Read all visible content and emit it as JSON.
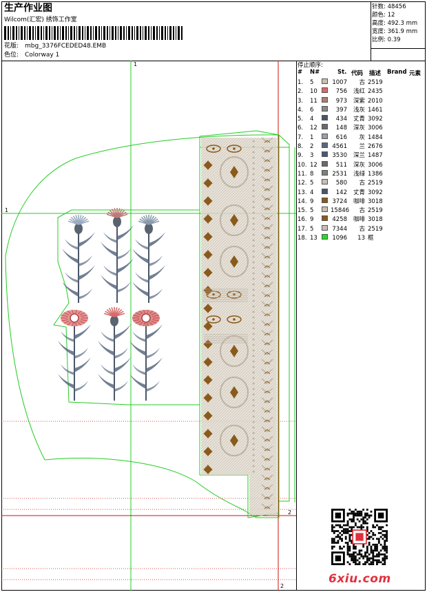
{
  "header": {
    "title": "生产作业图",
    "company": "Wilcom(汇宏) 绣饰工作室",
    "pattern_label": "花版:",
    "pattern_value": "mbg_3376FCEDED48.EMB",
    "color_label": "色位:",
    "color_value": "Colorway 1"
  },
  "stats": [
    {
      "label": "针数:",
      "value": "48456"
    },
    {
      "label": "颜色:",
      "value": "12"
    },
    {
      "label": "高度:",
      "value": "492.3 mm"
    },
    {
      "label": "宽度:",
      "value": "361.9 mm"
    },
    {
      "label": "比例:",
      "value": "0.39"
    }
  ],
  "sequence": {
    "title": "停止顺序:",
    "headers": {
      "num": "#",
      "needle": "N#",
      "st": "St.",
      "code": "代码",
      "desc": "描述",
      "brand": "Brand",
      "element": "元素"
    },
    "rows": [
      {
        "n": "1.",
        "needle": "5",
        "color": "#c8bfb4",
        "st": "1007",
        "code": "古",
        "desc": "2519"
      },
      {
        "n": "2.",
        "needle": "10",
        "color": "#d96a6a",
        "st": "756",
        "code": "浅红",
        "desc": "2435"
      },
      {
        "n": "3.",
        "needle": "11",
        "color": "#b08070",
        "st": "973",
        "code": "深紫",
        "desc": "2010"
      },
      {
        "n": "4.",
        "needle": "6",
        "color": "#8a8a8a",
        "st": "397",
        "code": "浅灰",
        "desc": "1461"
      },
      {
        "n": "5.",
        "needle": "4",
        "color": "#4a5668",
        "st": "434",
        "code": "丈青",
        "desc": "3092"
      },
      {
        "n": "6.",
        "needle": "12",
        "color": "#6a6a6a",
        "st": "148",
        "code": "深灰",
        "desc": "3006"
      },
      {
        "n": "7.",
        "needle": "1",
        "color": "#9aa0a8",
        "st": "616",
        "code": "灰",
        "desc": "1484"
      },
      {
        "n": "8.",
        "needle": "2",
        "color": "#586880",
        "st": "4561",
        "code": "兰",
        "desc": "2676"
      },
      {
        "n": "9.",
        "needle": "3",
        "color": "#485878",
        "st": "3530",
        "code": "深兰",
        "desc": "1487"
      },
      {
        "n": "10.",
        "needle": "12",
        "color": "#6a6a6a",
        "st": "511",
        "code": "深灰",
        "desc": "3006"
      },
      {
        "n": "11.",
        "needle": "8",
        "color": "#7a8478",
        "st": "2531",
        "code": "浅绿",
        "desc": "1386"
      },
      {
        "n": "12.",
        "needle": "5",
        "color": "#c8bfb4",
        "st": "580",
        "code": "古",
        "desc": "2519"
      },
      {
        "n": "13.",
        "needle": "4",
        "color": "#4a5668",
        "st": "142",
        "code": "丈青",
        "desc": "3092"
      },
      {
        "n": "14.",
        "needle": "9",
        "color": "#8a5a1a",
        "st": "3724",
        "code": "咖啡",
        "desc": "3018"
      },
      {
        "n": "15.",
        "needle": "5",
        "color": "#c8bfb4",
        "st": "15846",
        "code": "古",
        "desc": "2519"
      },
      {
        "n": "16.",
        "needle": "9",
        "color": "#8a5a1a",
        "st": "4258",
        "code": "咖啡",
        "desc": "3018"
      },
      {
        "n": "17.",
        "needle": "5",
        "color": "#c8bfb4",
        "st": "7344",
        "code": "古",
        "desc": "2519"
      },
      {
        "n": "18.",
        "needle": "13",
        "color": "#22dd22",
        "st": "1096",
        "code": "13",
        "desc": "框"
      }
    ]
  },
  "guides": {
    "v1": "1",
    "h1": "1",
    "v2": "2",
    "h2": "2"
  },
  "watermark": "6xiu.com",
  "colors": {
    "frame_green": "#22cc22",
    "guide_red": "#cc1111",
    "thread_brown": "#8a5a1a",
    "thread_beige": "#d0c8bc"
  }
}
